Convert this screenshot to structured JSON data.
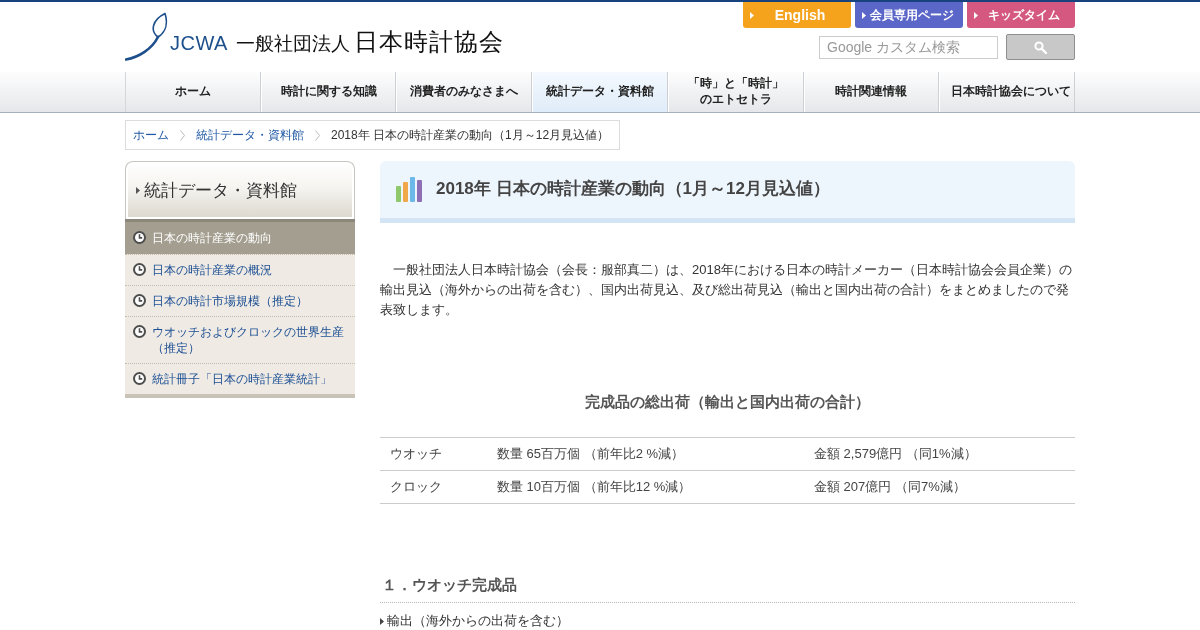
{
  "header": {
    "logo": {
      "abbr": "JCWA",
      "prefix": "一般社団法人",
      "name": "日本時計協会"
    },
    "top_links": [
      {
        "label": "English",
        "color": "#f5a21c"
      },
      {
        "label": "会員専用ページ",
        "color": "#5b66c9"
      },
      {
        "label": "キッズタイム",
        "color": "#d4587f"
      }
    ],
    "search": {
      "placeholder": "Google カスタム検索"
    }
  },
  "nav": [
    {
      "label": "ホーム",
      "selected": false
    },
    {
      "label": "時計に関する知識",
      "selected": false
    },
    {
      "label": "消費者のみなさまへ",
      "selected": false
    },
    {
      "label": "統計データ・資料館",
      "selected": true
    },
    {
      "label": "「時」と「時計」のエトセトラ",
      "selected": false
    },
    {
      "label": "時計関連情報",
      "selected": false
    },
    {
      "label": "日本時計協会について",
      "selected": false
    }
  ],
  "breadcrumb": [
    {
      "label": "ホーム",
      "kind": "link"
    },
    {
      "label": "統計データ・資料館",
      "kind": "link"
    },
    {
      "label": "2018年 日本の時計産業の動向（1月～12月見込値）",
      "kind": "current"
    }
  ],
  "sidebar": {
    "title": "統計データ・資料館",
    "items": [
      {
        "label": "日本の時計産業の動向",
        "selected": true
      },
      {
        "label": "日本の時計産業の概況",
        "selected": false
      },
      {
        "label": "日本の時計市場規模（推定）",
        "selected": false
      },
      {
        "label": "ウオッチおよびクロックの世界生産（推定）",
        "selected": false
      },
      {
        "label": "統計冊子「日本の時計産業統計」",
        "selected": false
      }
    ]
  },
  "main": {
    "title": "2018年 日本の時計産業の動向（1月～12月見込値）",
    "intro": "一般社団法人日本時計協会（会長：服部真二）は、2018年における日本の時計メーカー（日本時計協会会員企業）の輸出見込（海外からの出荷を含む）、国内出荷見込、及び総出荷見込（輸出と国内出荷の合計）をまとめましたので発表致します。",
    "summary_heading": "完成品の総出荷（輸出と国内出荷の合計）",
    "summary_table": {
      "rows": [
        {
          "cells": [
            "ウオッチ",
            "数量 65百万個 （前年比2 %減）",
            "金額 2,579億円 （同1%減）"
          ]
        },
        {
          "cells": [
            "クロック",
            "数量 10百万個 （前年比12 %減）",
            "金額 207億円 （同7%減）"
          ]
        }
      ]
    },
    "sections": [
      {
        "heading": "１．ウオッチ完成品",
        "items": [
          "輸出（海外からの出荷を含む）"
        ]
      }
    ]
  }
}
